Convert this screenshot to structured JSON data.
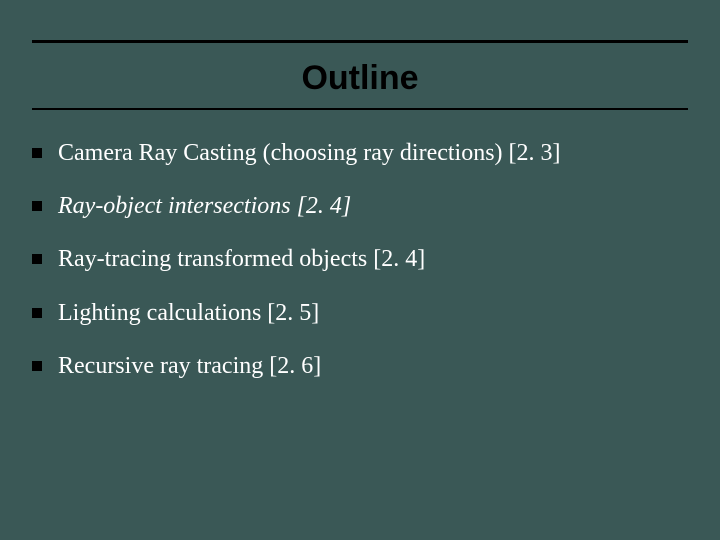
{
  "title": "Outline",
  "items": [
    {
      "text": "Camera Ray Casting (choosing ray directions) [2. 3]",
      "italic": false
    },
    {
      "text": "Ray-object intersections [2. 4]",
      "italic": true
    },
    {
      "text": "Ray-tracing transformed objects [2. 4]",
      "italic": false
    },
    {
      "text": "Lighting calculations [2. 5]",
      "italic": false
    },
    {
      "text": "Recursive ray tracing [2. 6]",
      "italic": false
    }
  ]
}
